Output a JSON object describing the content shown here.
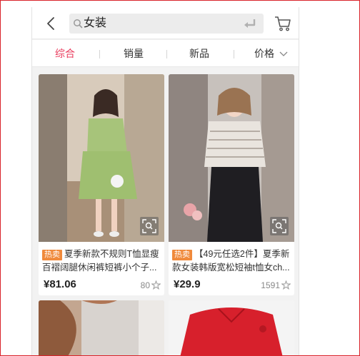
{
  "search": {
    "query": "女装",
    "back_icon": "chevron-left-icon",
    "search_icon": "magnifier-icon",
    "enter_icon": "enter-return-icon",
    "cart_icon": "shopping-cart-icon"
  },
  "sort_tabs": [
    {
      "label": "综合",
      "active": true
    },
    {
      "label": "销量",
      "active": false
    },
    {
      "label": "新品",
      "active": false
    },
    {
      "label": "价格",
      "active": false,
      "icon": "chevron-down-icon"
    }
  ],
  "colors": {
    "accent": "#e93b5c",
    "badge": "#f08a3c",
    "frame": "#d9232a"
  },
  "products": [
    {
      "badge": "热卖",
      "title": "夏季新款不规则T恤显瘦百褶阔腿休闲裤短裤小个子...",
      "price": "¥81.06",
      "sales": "80",
      "zoom_icon": "zoom-scan-icon",
      "fav_icon": "star-outline-icon"
    },
    {
      "badge": "热卖",
      "title": "【49元任选2件】夏季新款女装韩版宽松短袖t恤女ch...",
      "price": "¥29.9",
      "sales": "1591",
      "zoom_icon": "zoom-scan-icon",
      "fav_icon": "star-outline-icon"
    }
  ]
}
